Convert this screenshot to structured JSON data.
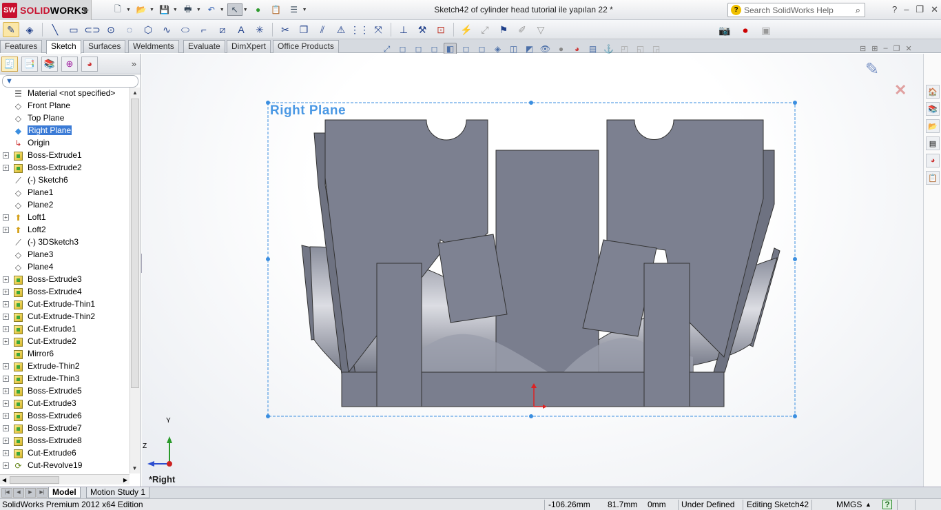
{
  "app": {
    "brand_prefix": "SOLID",
    "brand_suffix": "WORKS",
    "logo_mark": "SW"
  },
  "window": {
    "title": "Sketch42 of cylinder head tutorial ile yapılan 22 *"
  },
  "search": {
    "placeholder": "Search SolidWorks Help"
  },
  "command_tabs": [
    {
      "label": "Features",
      "active": false
    },
    {
      "label": "Sketch",
      "active": true
    },
    {
      "label": "Surfaces",
      "active": false
    },
    {
      "label": "Weldments",
      "active": false
    },
    {
      "label": "Evaluate",
      "active": false
    },
    {
      "label": "DimXpert",
      "active": false
    },
    {
      "label": "Office Products",
      "active": false
    }
  ],
  "feature_tree": {
    "filter_icon": "filter-icon",
    "items": [
      {
        "label": "Material <not specified>",
        "icon": "material-icon",
        "expandable": false
      },
      {
        "label": "Front Plane",
        "icon": "plane-icon",
        "expandable": false
      },
      {
        "label": "Top Plane",
        "icon": "plane-icon",
        "expandable": false
      },
      {
        "label": "Right Plane",
        "icon": "plane-icon",
        "expandable": false,
        "selected": true
      },
      {
        "label": "Origin",
        "icon": "origin-icon",
        "expandable": false
      },
      {
        "label": "Boss-Extrude1",
        "icon": "feature-icon",
        "expandable": true
      },
      {
        "label": "Boss-Extrude2",
        "icon": "feature-icon",
        "expandable": true
      },
      {
        "label": "(-) Sketch6",
        "icon": "sketch-icon",
        "expandable": false
      },
      {
        "label": "Plane1",
        "icon": "plane-icon",
        "expandable": false
      },
      {
        "label": "Plane2",
        "icon": "plane-icon",
        "expandable": false
      },
      {
        "label": "Loft1",
        "icon": "loft-icon",
        "expandable": true
      },
      {
        "label": "Loft2",
        "icon": "loft-icon",
        "expandable": true
      },
      {
        "label": "(-) 3DSketch3",
        "icon": "3dsketch-icon",
        "expandable": false
      },
      {
        "label": "Plane3",
        "icon": "plane-icon",
        "expandable": false
      },
      {
        "label": "Plane4",
        "icon": "plane-icon",
        "expandable": false
      },
      {
        "label": "Boss-Extrude3",
        "icon": "feature-icon",
        "expandable": true
      },
      {
        "label": "Boss-Extrude4",
        "icon": "feature-icon",
        "expandable": true
      },
      {
        "label": "Cut-Extrude-Thin1",
        "icon": "feature-icon",
        "expandable": true
      },
      {
        "label": "Cut-Extrude-Thin2",
        "icon": "feature-icon",
        "expandable": true
      },
      {
        "label": "Cut-Extrude1",
        "icon": "feature-icon",
        "expandable": true
      },
      {
        "label": "Cut-Extrude2",
        "icon": "feature-icon",
        "expandable": true
      },
      {
        "label": "Mirror6",
        "icon": "feature-icon",
        "expandable": false
      },
      {
        "label": "Extrude-Thin2",
        "icon": "feature-icon",
        "expandable": true
      },
      {
        "label": "Extrude-Thin3",
        "icon": "feature-icon",
        "expandable": true
      },
      {
        "label": "Boss-Extrude5",
        "icon": "feature-icon",
        "expandable": true
      },
      {
        "label": "Cut-Extrude3",
        "icon": "feature-icon",
        "expandable": true
      },
      {
        "label": "Boss-Extrude6",
        "icon": "feature-icon",
        "expandable": true
      },
      {
        "label": "Boss-Extrude7",
        "icon": "feature-icon",
        "expandable": true
      },
      {
        "label": "Boss-Extrude8",
        "icon": "feature-icon",
        "expandable": true
      },
      {
        "label": "Cut-Extrude6",
        "icon": "feature-icon",
        "expandable": true
      },
      {
        "label": "Cut-Revolve19",
        "icon": "revolve-icon",
        "expandable": true
      }
    ]
  },
  "graphics": {
    "plane_label": "Right Plane",
    "view_name": "*Right",
    "triad": {
      "y_label": "Y",
      "z_label": "Z"
    },
    "plane_color": "#3a8ee0",
    "part_color": "#7a7f8f"
  },
  "bottom_tabs": [
    {
      "label": "Model",
      "active": true
    },
    {
      "label": "Motion Study 1",
      "active": false
    }
  ],
  "status_bar": {
    "edition": "SolidWorks Premium 2012 x64 Edition",
    "x": "-106.26mm",
    "y": "81.7mm",
    "z": "0mm",
    "state": "Under Defined",
    "editing": "Editing Sketch42",
    "units": "MMGS"
  }
}
